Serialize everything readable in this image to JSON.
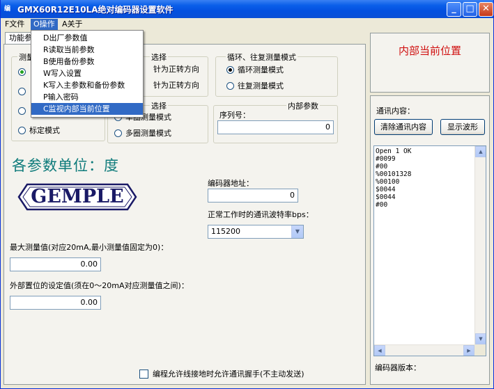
{
  "window": {
    "title": "GMX60R12E10LA绝对编码器设置软件",
    "icon_text": "编",
    "minimize": "_",
    "maximize": "□",
    "close": "✕"
  },
  "menubar": {
    "file": "F文件",
    "operate": "O操作",
    "about": "A关于"
  },
  "dropdown": [
    "D出厂参数值",
    "R读取当前参数",
    "B使用备份参数",
    "W写入设置",
    "K写入主参数和备份参数",
    "P输入密码",
    "C监视内部当前位置"
  ],
  "tab": {
    "label": "功能参"
  },
  "measure_group": {
    "title": "测量",
    "options": [
      "",
      "",
      "",
      "标定模式"
    ],
    "selected_index": 0
  },
  "direction_group": {
    "title": "选择",
    "options": [
      "针为正转方向",
      "针为正转方向"
    ]
  },
  "cycle_group": {
    "title": "循环、往复测量模式",
    "options": [
      "循环测量模式",
      "往复测量模式"
    ],
    "selected_index": 0
  },
  "turns_group": {
    "title": "选择",
    "options": [
      "单圈测量模式",
      "多圈测量模式"
    ]
  },
  "internal_group": {
    "title": "内部参数",
    "serial_label": "序列号：",
    "serial_value": "0"
  },
  "units_title": "各参数单位：度",
  "logo_text": "GEMPLE",
  "address": {
    "label": "编码器地址：",
    "value": "0"
  },
  "baud": {
    "label": "正常工作时的通讯波特率bps：",
    "value": "115200"
  },
  "max_measure": {
    "label": "最大测量值(对应20mA,最小测量值固定为0)：",
    "value": "0.00"
  },
  "external_pos": {
    "label": "外部置位的设定值(须在0～20mA对应测量值之间)：",
    "value": "0.00"
  },
  "handshake_checkbox": {
    "label": "编程允许线接地时允许通讯握手(不主动发送)",
    "checked": false
  },
  "position_panel": {
    "title": "内部当前位置"
  },
  "comm_panel": {
    "title": "通讯内容：",
    "clear_button": "清除通讯内容",
    "wave_button": "显示波形",
    "log": [
      "Open 1 OK",
      "#0099",
      "#00",
      "%00101328",
      "%00100",
      "$0044",
      "$0044",
      "#00"
    ],
    "version_label": "编码器版本："
  },
  "colors": {
    "titlebar": "#0a5fe9",
    "highlight": "#316ac5",
    "position_title": "#d01010",
    "units_title": "#0e7b7b"
  }
}
